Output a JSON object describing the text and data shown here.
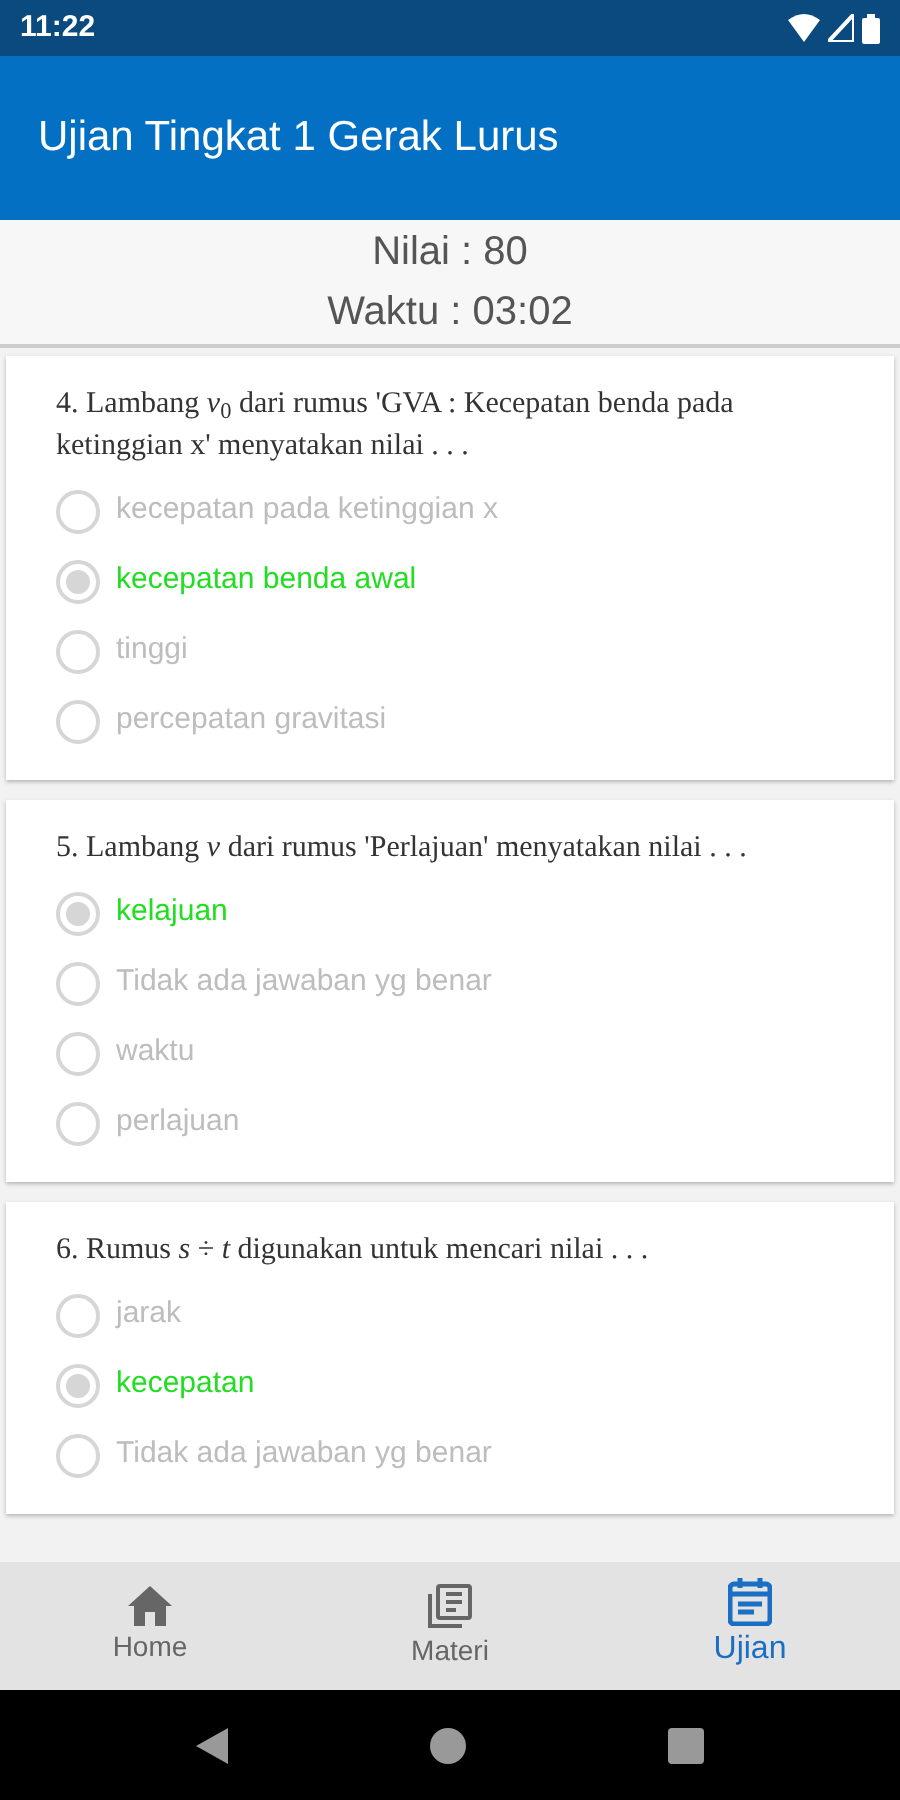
{
  "status_bar": {
    "time": "11:22"
  },
  "app_bar": {
    "title": "Ujian Tingkat 1 Gerak Lurus"
  },
  "summary": {
    "score": "Nilai : 80",
    "time": "Waktu : 03:02"
  },
  "questions": [
    {
      "text": "4. Lambang *v*$_{0}$ dari rumus 'GVA : Kecepatan benda pada ketinggian x' menyatakan nilai . . .",
      "options": [
        {
          "label": "kecepatan pada ketinggian x",
          "selected": false
        },
        {
          "label": "kecepatan benda awal",
          "selected": true
        },
        {
          "label": "tinggi",
          "selected": false
        },
        {
          "label": "percepatan gravitasi",
          "selected": false
        }
      ]
    },
    {
      "text": "5. Lambang *v* dari rumus 'Perlajuan' menyatakan nilai . . .",
      "options": [
        {
          "label": "kelajuan",
          "selected": true
        },
        {
          "label": "Tidak ada jawaban yg benar",
          "selected": false
        },
        {
          "label": "waktu",
          "selected": false
        },
        {
          "label": "perlajuan",
          "selected": false
        }
      ]
    },
    {
      "text": "6. Rumus *s* ÷ *t* digunakan untuk mencari nilai . . .",
      "options": [
        {
          "label": "jarak",
          "selected": false
        },
        {
          "label": "kecepatan",
          "selected": true
        },
        {
          "label": "Tidak ada jawaban yg benar",
          "selected": false
        }
      ]
    }
  ],
  "bottom_nav": [
    {
      "label": "Home",
      "selected": false
    },
    {
      "label": "Materi",
      "selected": false
    },
    {
      "label": "Ujian",
      "selected": true
    }
  ]
}
